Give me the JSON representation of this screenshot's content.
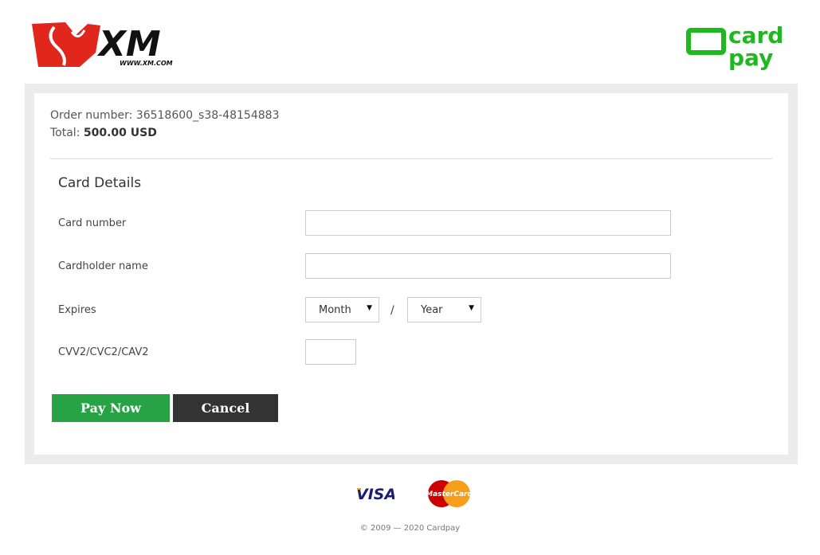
{
  "brand": {
    "xm_logo_text": "XM",
    "xm_url": "WWW.XM.COM",
    "cardpay_line1": "card",
    "cardpay_line2": "pay",
    "cardpay_color": "#1fb81f",
    "xm_red": "#e1261c"
  },
  "order": {
    "number_label": "Order number: ",
    "number_value": "36518600_s38-48154883",
    "total_label": "Total: ",
    "total_value": "500.00 USD"
  },
  "form": {
    "section_title": "Card Details",
    "card_number_label": "Card number",
    "card_number_value": "",
    "cardholder_label": "Cardholder name",
    "cardholder_value": "",
    "expires_label": "Expires",
    "month_selected": "Month",
    "year_selected": "Year",
    "separator": "/",
    "cvv_label": "CVV2/CVC2/CAV2",
    "cvv_value": ""
  },
  "actions": {
    "pay_label": "Pay Now",
    "cancel_label": "Cancel",
    "pay_color": "#27a244",
    "cancel_color": "#333333"
  },
  "payment_logos": {
    "visa_text": "VISA",
    "mastercard_text": "MasterCard"
  },
  "footer": {
    "copyright": "© 2009 — 2020 Cardpay"
  }
}
